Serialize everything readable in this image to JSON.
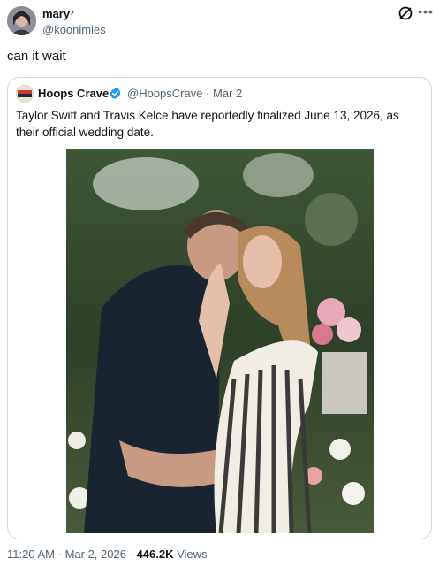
{
  "author": {
    "name": "mary⁷",
    "handle": "@koonimies"
  },
  "tweet": {
    "text": "can it wait"
  },
  "quoted": {
    "name": "Hoops Crave",
    "handle": "@HoopsCrave",
    "separator": "·",
    "date": "Mar 2",
    "text": "Taylor Swift and Travis Kelce have reportedly finalized June 13, 2026, as their official wedding date.",
    "logo_text": "HOOPS CRAVE",
    "verified_color": "#1d9bf0"
  },
  "meta": {
    "time": "11:20 AM",
    "separator": "·",
    "date": "Mar 2, 2026",
    "views": "446.2K",
    "views_label": "Views"
  },
  "icons": {
    "grok": "grok-icon",
    "more": "more-icon",
    "verified": "verified-badge-icon"
  }
}
